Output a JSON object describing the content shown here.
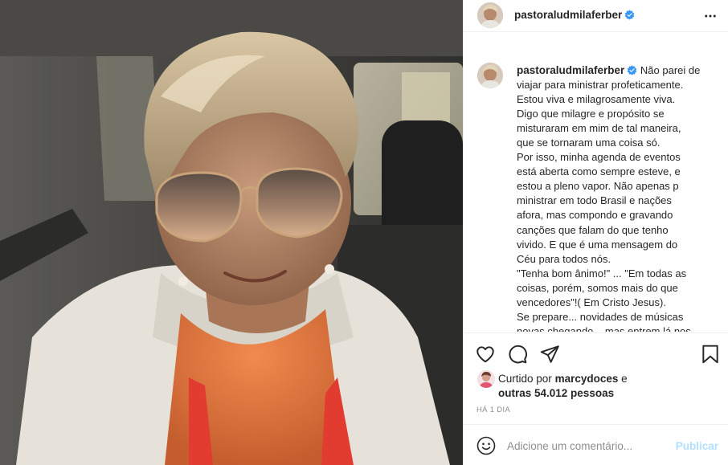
{
  "post": {
    "username": "pastoraludmilaferber",
    "verified": true,
    "photo_alt": "Selfie de mulher com óculos de sol aviador dentro de um carro"
  },
  "caption": {
    "username": "pastoraludmilaferber",
    "lines": [
      "Não parei de",
      "viajar para ministrar profeticamente.",
      "Estou viva e milagrosamente viva.",
      "Digo que milagre e propósito se",
      "misturaram em mim de tal maneira,",
      "que se tornaram uma coisa só.",
      "Por isso, minha agenda de eventos",
      "está aberta como sempre esteve, e",
      "estou a pleno vapor. Não apenas p",
      "ministrar em todo Brasil e nações",
      "afora, mas compondo e gravando",
      "canções que falam do que tenho",
      "vivido. E que é uma mensagem do",
      "Céu para todos nós.",
      "\"Tenha bom ânimo!\" ... \"Em todas as",
      "coisas, porém, somos mais do que",
      "vencedores\"!( Em Cristo Jesus).",
      "Se prepare... novidades de músicas",
      "novas chegando... mas entrem lá nos"
    ]
  },
  "likes": {
    "prefix": "Curtido por",
    "user": "marcydoces",
    "joiner": "e",
    "others": "outras 54.012 pessoas"
  },
  "timestamp": "HÁ 1 DIA",
  "comment": {
    "placeholder": "Adicione um comentário...",
    "publish_label": "Publicar"
  },
  "icons": {
    "like": "heart-icon",
    "comment": "comment-icon",
    "share": "share-icon",
    "save": "bookmark-icon",
    "more": "more-icon",
    "emoji": "emoji-icon",
    "verified": "verified-badge-icon"
  },
  "colors": {
    "verified": "#3897f0",
    "publish_disabled": "#b2dffc",
    "secondary_text": "#8e8e8e",
    "border": "#efefef"
  }
}
